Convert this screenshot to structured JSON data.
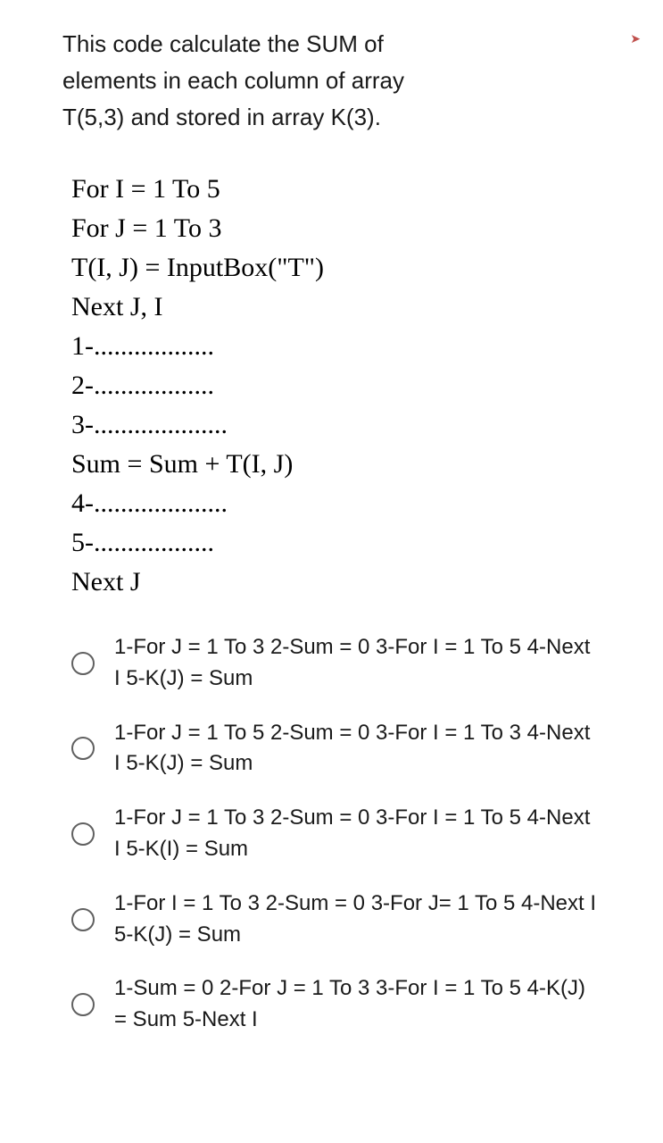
{
  "header_arrow": "➤",
  "question": {
    "line1": "This code calculate the SUM of",
    "line2": "elements  in each column of array",
    "line3": "T(5,3) and stored in array K(3)."
  },
  "code": {
    "l1": "For I = 1 To 5",
    "l2": "For J = 1 To 3",
    "l3": "T(I, J) = InputBox(\"T\")",
    "l4": "Next J, I",
    "l5": "1-..................",
    "l6": "2-..................",
    "l7": "3-....................",
    "l8": "Sum = Sum + T(I, J)",
    "l9": "4-....................",
    "l10": "5-..................",
    "l11": "Next J"
  },
  "options": [
    "1-For J = 1 To 3 2-Sum = 0 3-For I = 1 To 5 4-Next I 5-K(J) = Sum",
    "1-For J = 1 To 5 2-Sum = 0 3-For I = 1 To 3 4-Next I 5-K(J) = Sum",
    "1-For J = 1 To 3 2-Sum = 0 3-For I = 1 To 5 4-Next I 5-K(I) = Sum",
    "1-For I = 1 To 3 2-Sum = 0 3-For J= 1 To 5 4-Next I 5-K(J) = Sum",
    "1-Sum = 0 2-For J = 1 To 3 3-For I = 1 To 5 4-K(J) = Sum 5-Next I"
  ]
}
